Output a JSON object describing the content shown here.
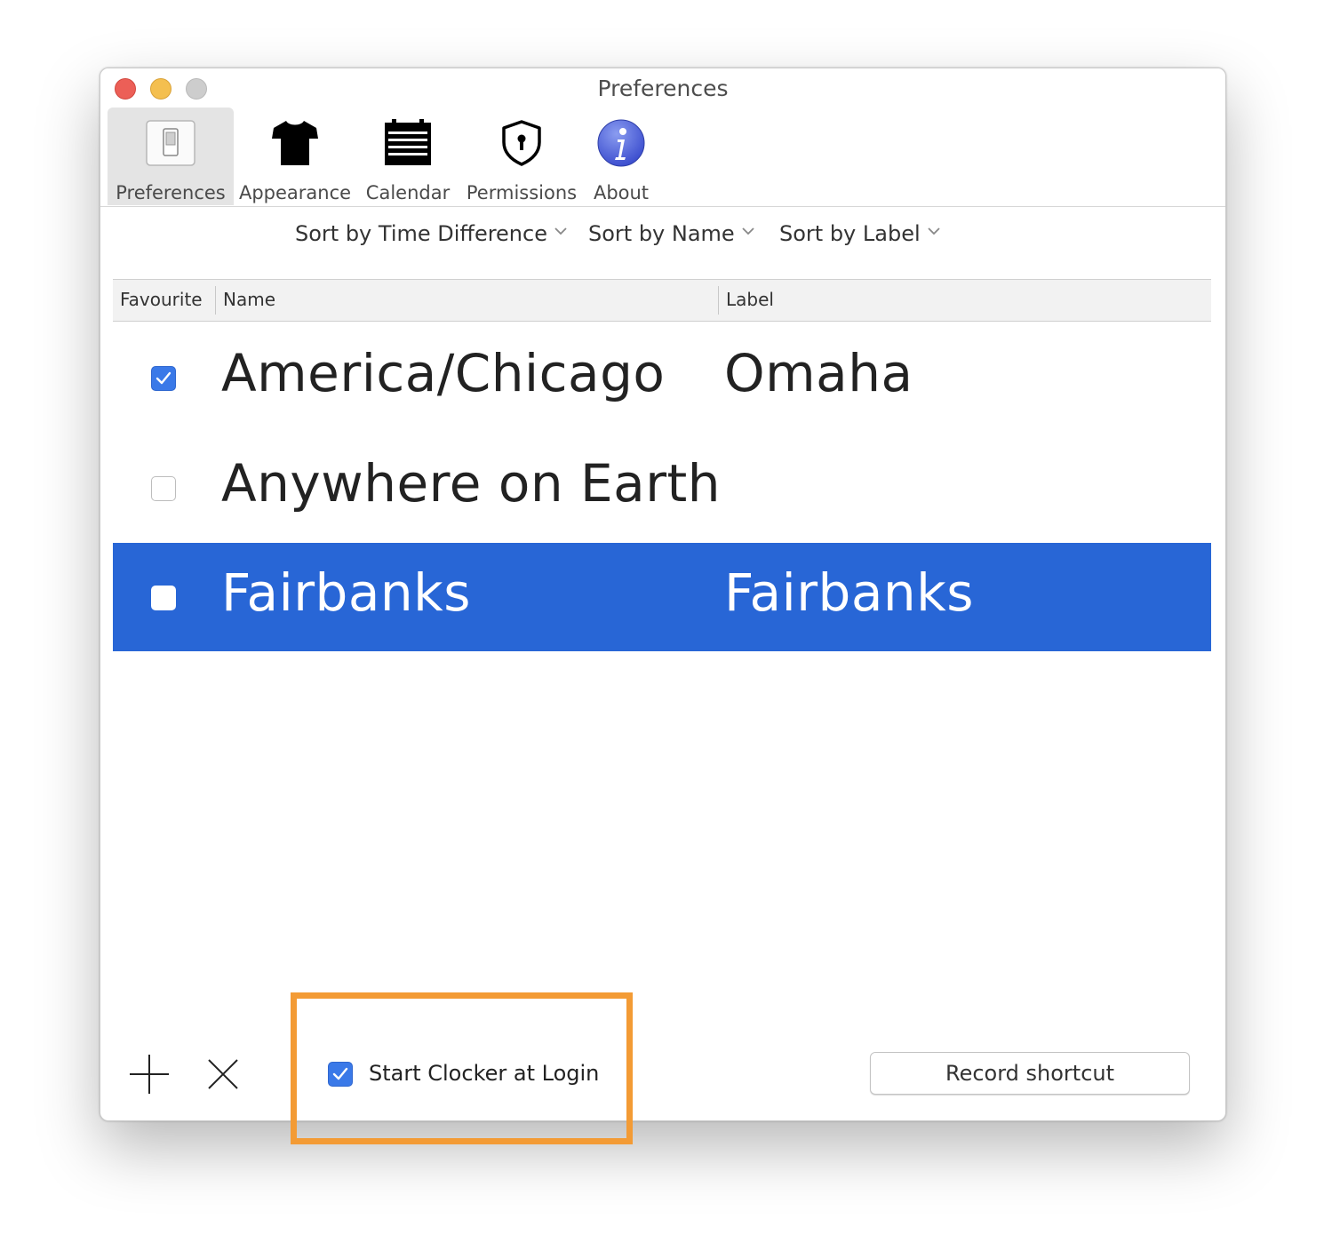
{
  "window": {
    "title": "Preferences",
    "traffic_lights": [
      "close",
      "minimize",
      "zoom"
    ]
  },
  "toolbar": {
    "tabs": [
      {
        "label": "Preferences",
        "icon": "switch-icon",
        "selected": true
      },
      {
        "label": "Appearance",
        "icon": "tshirt-icon",
        "selected": false
      },
      {
        "label": "Calendar",
        "icon": "calendar-icon",
        "selected": false
      },
      {
        "label": "Permissions",
        "icon": "shield-icon",
        "selected": false
      },
      {
        "label": "About",
        "icon": "info-icon",
        "selected": false
      }
    ]
  },
  "sort": {
    "time_difference": "Sort by Time Difference",
    "name": "Sort by Name",
    "label": "Sort by Label"
  },
  "table": {
    "columns": [
      "Favourite",
      "Name",
      "Label"
    ],
    "rows": [
      {
        "favourite": true,
        "name": "America/Chicago",
        "label": "Omaha",
        "selected": false
      },
      {
        "favourite": false,
        "name": "Anywhere on Earth",
        "label": "",
        "selected": false
      },
      {
        "favourite": false,
        "name": "Fairbanks",
        "label": "Fairbanks",
        "selected": true
      }
    ]
  },
  "footer": {
    "start_at_login_label": "Start Clocker at Login",
    "start_at_login_checked": true,
    "record_shortcut_label": "Record shortcut"
  },
  "colors": {
    "selection": "#2866d6",
    "checkbox_on": "#3a79e8",
    "highlight": "#f39b35"
  }
}
